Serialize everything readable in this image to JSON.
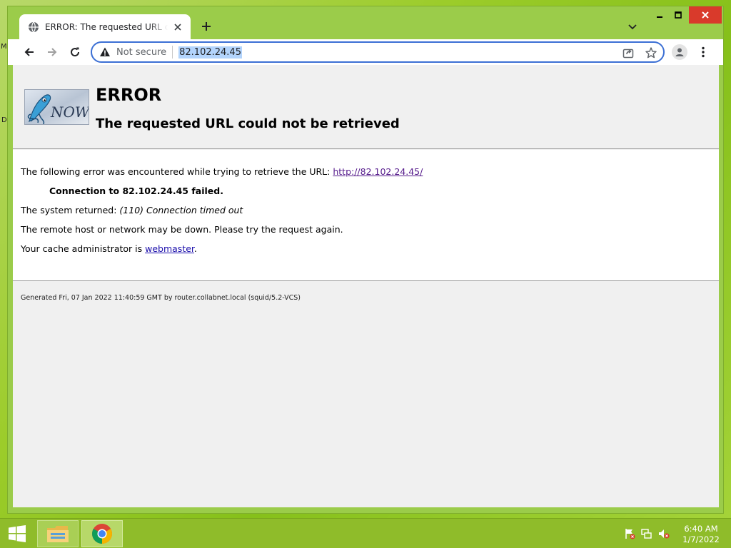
{
  "desktop": {
    "edge_left_top": "M",
    "edge_left_mid": "D"
  },
  "browser": {
    "tab": {
      "title": "ERROR: The requested URL could not be retrieved",
      "favicon": "globe-icon",
      "close_icon": "close-icon"
    },
    "new_tab_icon": "plus-icon",
    "tab_search_icon": "chevron-down-icon",
    "window_controls": [
      "minimize-icon",
      "maximize-icon",
      "close-icon"
    ],
    "toolbar": {
      "back_icon": "arrow-left-icon",
      "forward_icon": "arrow-right-icon",
      "reload_icon": "reload-icon"
    },
    "omnibox": {
      "security_icon": "warning-icon",
      "security_label": "Not secure",
      "url": "82.102.24.45",
      "share_icon": "share-icon",
      "bookmark_icon": "star-icon"
    },
    "profile_icon": "person-icon",
    "menu_icon": "kebab-icon",
    "accent_color": "#3b6fd4"
  },
  "page": {
    "logo_text": "NOW",
    "heading": "ERROR",
    "subheading": "The requested URL could not be retrieved",
    "line1_prefix": "The following error was encountered while trying to retrieve the URL: ",
    "line1_link": "http://82.102.24.45/",
    "line2": "Connection to 82.102.24.45 failed.",
    "line3_prefix": "The system returned: ",
    "line3_italic": "(110) Connection timed out",
    "line4": "The remote host or network may be down. Please try the request again.",
    "line5_prefix": "Your cache administrator is ",
    "line5_link": "webmaster",
    "line5_suffix": ".",
    "footer": "Generated Fri, 07 Jan 2022 11:40:59 GMT by router.collabnet.local (squid/5.2-VCS)"
  },
  "taskbar": {
    "start_icon": "windows-logo-icon",
    "apps": [
      "file-explorer-icon",
      "chrome-icon"
    ],
    "tray": [
      "flag-icon",
      "network-icon",
      "volume-muted-icon"
    ],
    "time": "6:40 AM",
    "date": "1/7/2022"
  }
}
